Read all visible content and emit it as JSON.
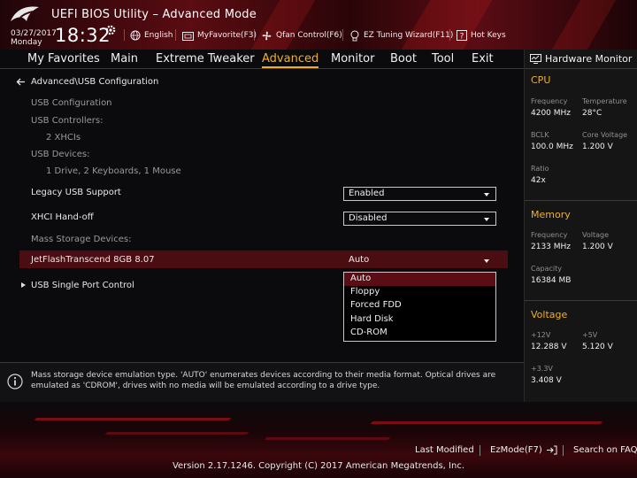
{
  "header": {
    "title": "UEFI BIOS Utility – Advanced Mode",
    "date": "03/27/2017",
    "weekday": "Monday",
    "time": "18:32",
    "tools": {
      "language": "English",
      "myfavorite": "MyFavorite(F3)",
      "qfan": "Qfan Control(F6)",
      "ez_tuning": "EZ Tuning Wizard(F11)",
      "hotkeys": "Hot Keys"
    }
  },
  "menu": {
    "items": [
      "My Favorites",
      "Main",
      "Extreme Tweaker",
      "Advanced",
      "Monitor",
      "Boot",
      "Tool",
      "Exit"
    ],
    "active": "Advanced"
  },
  "main": {
    "breadcrumb": "Advanced\\USB Configuration",
    "usb_config_label": "USB Configuration",
    "usb_controllers_label": "USB Controllers:",
    "usb_controllers_value": "2 XHCIs",
    "usb_devices_label": "USB Devices:",
    "usb_devices_value": "1 Drive, 2 Keyboards, 1 Mouse",
    "legacy_label": "Legacy USB Support",
    "legacy_value": "Enabled",
    "xhci_label": "XHCI Hand-off",
    "xhci_value": "Disabled",
    "mass_storage_label": "Mass Storage Devices:",
    "jetflash_label": "JetFlashTranscend 8GB 8.07",
    "jetflash_value": "Auto",
    "single_port_label": "USB Single Port Control",
    "dropdown_options": [
      "Auto",
      "Floppy",
      "Forced FDD",
      "Hard Disk",
      "CD-ROM"
    ],
    "dropdown_selected": "Auto"
  },
  "help": {
    "text": "Mass storage device emulation type. 'AUTO' enumerates devices according to their media format. Optical drives are emulated as 'CDROM', drives with no media will be emulated according to a drive type."
  },
  "hwmon": {
    "title": "Hardware Monitor",
    "cpu": {
      "title": "CPU",
      "frequency_label": "Frequency",
      "frequency": "4200 MHz",
      "temperature_label": "Temperature",
      "temperature": "28°C",
      "bclk_label": "BCLK",
      "bclk": "100.0 MHz",
      "core_voltage_label": "Core Voltage",
      "core_voltage": "1.200 V",
      "ratio_label": "Ratio",
      "ratio": "42x"
    },
    "memory": {
      "title": "Memory",
      "frequency_label": "Frequency",
      "frequency": "2133 MHz",
      "voltage_label": "Voltage",
      "voltage": "1.200 V",
      "capacity_label": "Capacity",
      "capacity": "16384 MB"
    },
    "voltage": {
      "title": "Voltage",
      "v12_label": "+12V",
      "v12": "12.288 V",
      "v5_label": "+5V",
      "v5": "5.120 V",
      "v33_label": "+3.3V",
      "v33": "3.408 V"
    }
  },
  "footer": {
    "last_modified": "Last Modified",
    "ezmode": "EzMode(F7)",
    "search_faq": "Search on FAQ",
    "copyright": "Version 2.17.1246. Copyright (C) 2017 American Megatrends, Inc."
  },
  "colors": {
    "accent": "#f2b020",
    "highlight": "#4a0d12",
    "brand_red": "#5a0c12"
  }
}
